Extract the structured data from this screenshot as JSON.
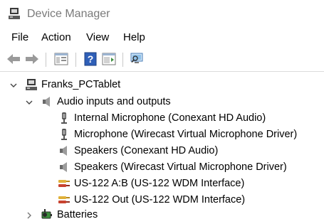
{
  "window": {
    "title": "Device Manager",
    "title_icon": "device-manager-icon"
  },
  "menubar": {
    "items": [
      "File",
      "Action",
      "View",
      "Help"
    ]
  },
  "toolbar": {
    "buttons": [
      "back-arrow-icon",
      "forward-arrow-icon",
      "properties-pane-icon",
      "help-icon",
      "action-pane-icon",
      "scan-hardware-icon"
    ]
  },
  "tree": {
    "root": "Franks_PCTablet",
    "category_audio": "Audio inputs and outputs",
    "audio_devices": [
      "Internal Microphone (Conexant HD Audio)",
      "Microphone (Wirecast Virtual Microphone Driver)",
      "Speakers (Conexant HD Audio)",
      "Speakers (Wirecast Virtual Microphone Driver)",
      "US-122 A:B (US-122 WDM Interface)",
      "US-122 Out (US-122 WDM Interface)"
    ],
    "category_batteries": "Batteries"
  }
}
